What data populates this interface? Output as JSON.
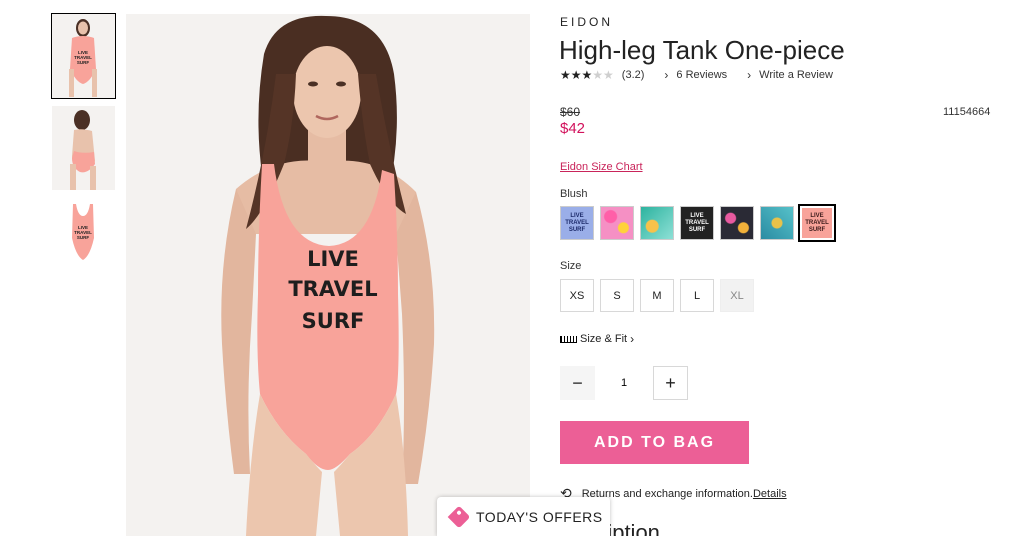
{
  "product": {
    "brand": "EIDON",
    "title": "High-leg Tank One-piece",
    "rating_value": "(3.2)",
    "rating_stars": 3.2,
    "reviews_label": "6 Reviews",
    "write_review_label": "Write a Review",
    "old_price": "$60",
    "new_price": "$42",
    "sku": "11154664",
    "size_chart_label": "Eidon Size Chart",
    "color_name": "Blush",
    "size_label": "Size",
    "sizes": [
      "XS",
      "S",
      "M",
      "L",
      "XL"
    ],
    "size_fit_label": "Size & Fit",
    "quantity": "1",
    "add_to_bag_label": "ADD TO BAG",
    "returns_text": "Returns and exchange information.",
    "returns_link": "Details",
    "description_heading": "ription",
    "print_text": [
      "LIVE",
      "TRAVEL",
      "SURF"
    ]
  },
  "swatches": [
    {
      "name": "periwinkle-live-travel-surf",
      "color": "#9aaee8",
      "text": [
        "LIVE",
        "TRAVEL",
        "SURF"
      ],
      "text_color": "#1c2a6a"
    },
    {
      "name": "floral-pink",
      "color": "#f590c4",
      "text": [],
      "text_color": ""
    },
    {
      "name": "tropical-teal",
      "color": "#4fc7c5",
      "text": [],
      "text_color": ""
    },
    {
      "name": "black-live-travel-surf",
      "color": "#222222",
      "text": [
        "LIVE",
        "TRAVEL",
        "SURF"
      ],
      "text_color": "#ffffff"
    },
    {
      "name": "dark-floral",
      "color": "#2a2a35",
      "text": [],
      "text_color": ""
    },
    {
      "name": "teal-pattern",
      "color": "#3a9fb0",
      "text": [],
      "text_color": ""
    },
    {
      "name": "blush-live-travel-surf",
      "color": "#f8a39a",
      "text": [
        "LIVE",
        "TRAVEL",
        "SURF"
      ],
      "text_color": "#3a1a1a"
    }
  ],
  "offers": {
    "label": "TODAY'S OFFERS"
  },
  "colors": {
    "accent": "#ec5f96",
    "sale_price": "#d2125c",
    "swimsuit": "#f8a39a"
  }
}
